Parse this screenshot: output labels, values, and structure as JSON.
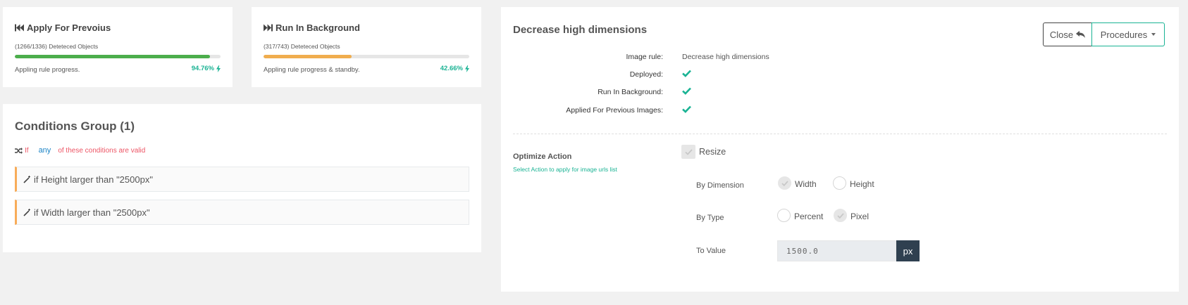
{
  "cards": [
    {
      "title": "Apply For Prevoius",
      "icon": "fast-backward-icon",
      "subtitle": "(1266/1336) Deteteced Objects",
      "progress": 0.9476,
      "color": "#4cae4c",
      "note": "Appling rule progress.",
      "percent": "94.76%"
    },
    {
      "title": "Run In Background",
      "icon": "fast-forward-icon",
      "subtitle": "(317/743) Deteteced Objects",
      "progress": 0.4266,
      "color": "#f0ad4e",
      "note": "Appling rule progress & standby.",
      "percent": "42.66%"
    }
  ],
  "conditions": {
    "title": "Conditions Group (1)",
    "if_label": "If",
    "mode": "any",
    "rest": "of these conditions are valid",
    "items": [
      {
        "text": "if Height larger than \"2500px\""
      },
      {
        "text": "if Width larger than \"2500px\""
      }
    ]
  },
  "detail": {
    "title": "Decrease high dimensions",
    "close_label": "Close",
    "procedures_label": "Procedures",
    "rows": [
      {
        "label": "Image rule:",
        "value": "Decrease high dimensions"
      },
      {
        "label": "Deployed:",
        "checked": true
      },
      {
        "label": "Run In Background:",
        "checked": true
      },
      {
        "label": "Applied For Previous Images:",
        "checked": true
      }
    ],
    "optimize": {
      "title": "Optimize Action",
      "subtitle": "Select Action to apply for image urls list",
      "resize_label": "Resize",
      "resize_checked": true,
      "by_dimension_label": "By Dimension",
      "width_label": "Width",
      "width_selected": true,
      "height_label": "Height",
      "height_selected": false,
      "by_type_label": "By Type",
      "percent_label": "Percent",
      "percent_selected": false,
      "pixel_label": "Pixel",
      "pixel_selected": true,
      "to_value_label": "To Value",
      "value": "1500.0",
      "unit": "px"
    }
  },
  "colors": {
    "accent": "#1ab394",
    "danger": "#ed5565",
    "link": "#1c84c6",
    "warning": "#f8ac59",
    "dark": "#2f4050"
  }
}
